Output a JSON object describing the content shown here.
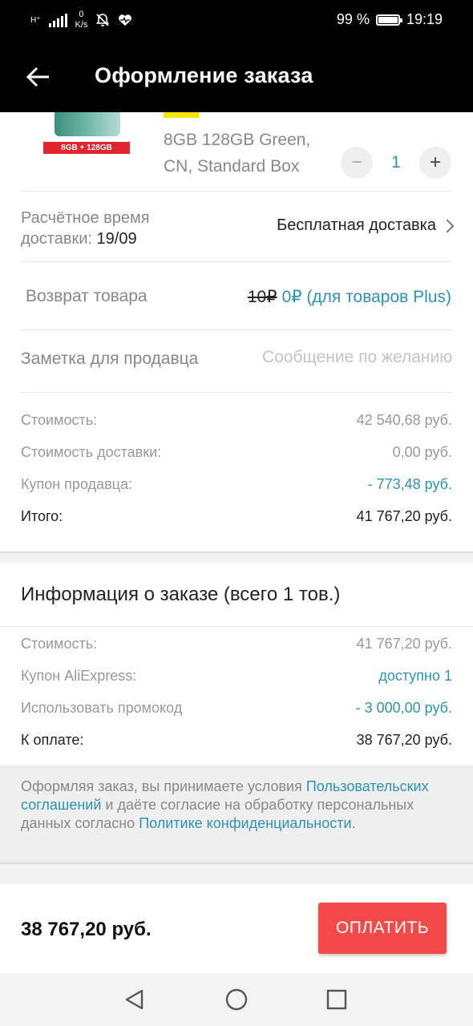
{
  "status_bar": {
    "network": "H⁺",
    "speed_value": "0",
    "speed_unit": "K/s",
    "battery_percent": "99 %",
    "battery_level": 0.99,
    "time": "19:19",
    "icons": [
      "signal-icon",
      "mute-bell-icon",
      "health-heart-icon",
      "battery-icon"
    ]
  },
  "header": {
    "title": "Оформление заказа",
    "back_icon": "arrow-left-icon"
  },
  "product": {
    "image_badge": "8GB + 128GB",
    "variant": "8GB 128GB Green, CN, Standard Box",
    "quantity": "1",
    "minus_label": "−",
    "plus_label": "+"
  },
  "delivery": {
    "label": "Расчётное время доставки:",
    "date": "19/09",
    "value": "Бесплатная доставка"
  },
  "return": {
    "label": "Возврат товара",
    "old_price": "10₽",
    "new_price": "0₽ (для товаров Plus)"
  },
  "seller_note": {
    "label": "Заметка для продавца",
    "placeholder": "Сообщение по желанию",
    "value": ""
  },
  "store_summary": [
    {
      "label": "Стоимость:",
      "value": "42 540,68 руб."
    },
    {
      "label": "Стоимость доставки:",
      "value": "0,00 руб."
    },
    {
      "label": "Купон продавца:",
      "value": "- 773,48 руб."
    },
    {
      "label": "Итого:",
      "value": "41 767,20 руб."
    }
  ],
  "order_info": {
    "title": "Информация о заказе (всего 1 тов.)",
    "lines": [
      {
        "label": "Стоимость:",
        "value": "41 767,20 руб."
      },
      {
        "label": "Купон AliExpress:",
        "value": "доступно 1"
      },
      {
        "label": "Использовать промокод",
        "value": "- 3 000,00 руб."
      },
      {
        "label": "К оплате:",
        "value": "38 767,20 руб."
      }
    ]
  },
  "terms": {
    "part1": "Оформляя заказ, вы принимаете условия ",
    "link1": "Пользовательских соглашений",
    "part2": " и даёте согласие на обработку персональных данных согласно ",
    "link2": "Политике конфиденциальности",
    "part3": "."
  },
  "footer": {
    "total": "38 767,20 руб.",
    "pay_label": "ОПЛАТИТЬ"
  },
  "colors": {
    "accent_blue": "#2c93b4",
    "pay_red": "#f44a4a",
    "header_bg": "#000000"
  },
  "nav_icons": [
    "back-triangle-icon",
    "home-circle-icon",
    "recents-square-icon"
  ]
}
